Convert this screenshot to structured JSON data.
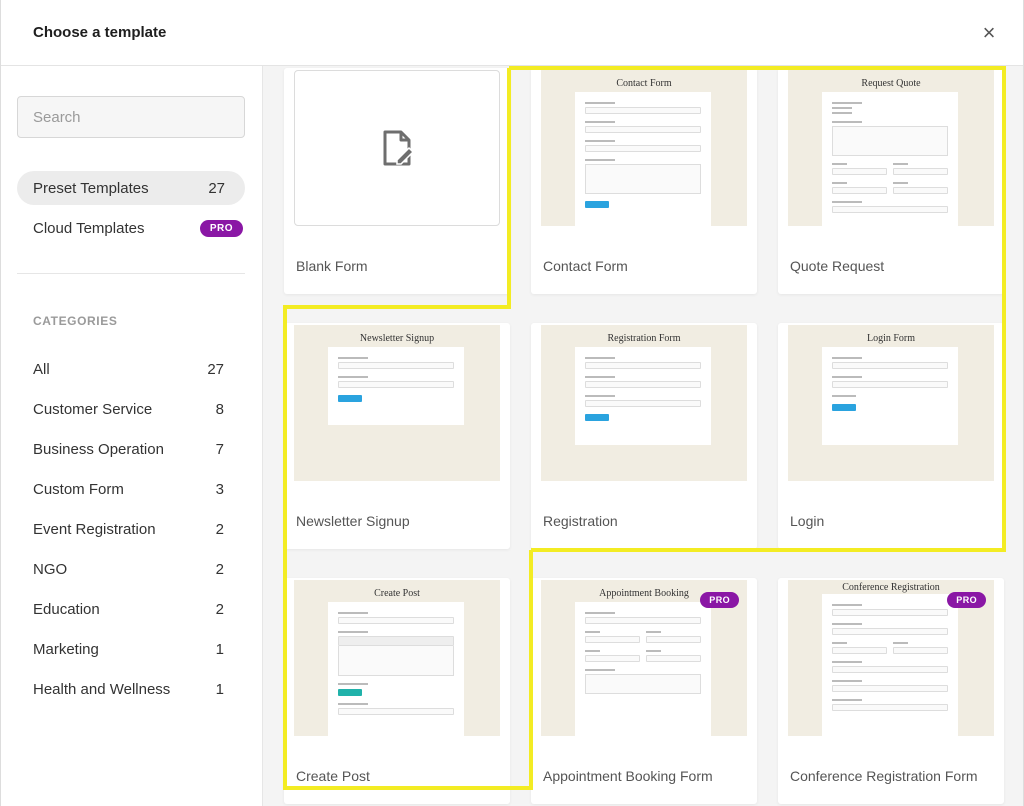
{
  "header": {
    "title": "Choose a template",
    "close_icon": "×"
  },
  "search": {
    "placeholder": "Search"
  },
  "nav": [
    {
      "label": "Preset Templates",
      "count": "27",
      "active": true
    },
    {
      "label": "Cloud Templates",
      "badge": "PRO"
    }
  ],
  "categories_title": "CATEGORIES",
  "categories": [
    {
      "label": "All",
      "count": "27"
    },
    {
      "label": "Customer Service",
      "count": "8"
    },
    {
      "label": "Business Operation",
      "count": "7"
    },
    {
      "label": "Custom Form",
      "count": "3"
    },
    {
      "label": "Event Registration",
      "count": "2"
    },
    {
      "label": "NGO",
      "count": "2"
    },
    {
      "label": "Education",
      "count": "2"
    },
    {
      "label": "Marketing",
      "count": "1"
    },
    {
      "label": "Health and Wellness",
      "count": "1"
    }
  ],
  "templates": [
    {
      "label": "Blank Form",
      "thumb_title": ""
    },
    {
      "label": "Contact Form",
      "thumb_title": "Contact Form"
    },
    {
      "label": "Quote Request",
      "thumb_title": "Request Quote"
    },
    {
      "label": "Newsletter Signup",
      "thumb_title": "Newsletter Signup"
    },
    {
      "label": "Registration",
      "thumb_title": "Registration Form"
    },
    {
      "label": "Login",
      "thumb_title": "Login Form"
    },
    {
      "label": "Create Post",
      "thumb_title": "Create Post"
    },
    {
      "label": "Appointment Booking Form",
      "thumb_title": "Appointment Booking",
      "badge": "PRO"
    },
    {
      "label": "Conference Registration Form",
      "thumb_title": "Conference Registration",
      "badge": "PRO"
    }
  ],
  "colors": {
    "pro": "#8a17a5",
    "highlight": "#f3ec23",
    "button_blue": "#2aa3df"
  }
}
